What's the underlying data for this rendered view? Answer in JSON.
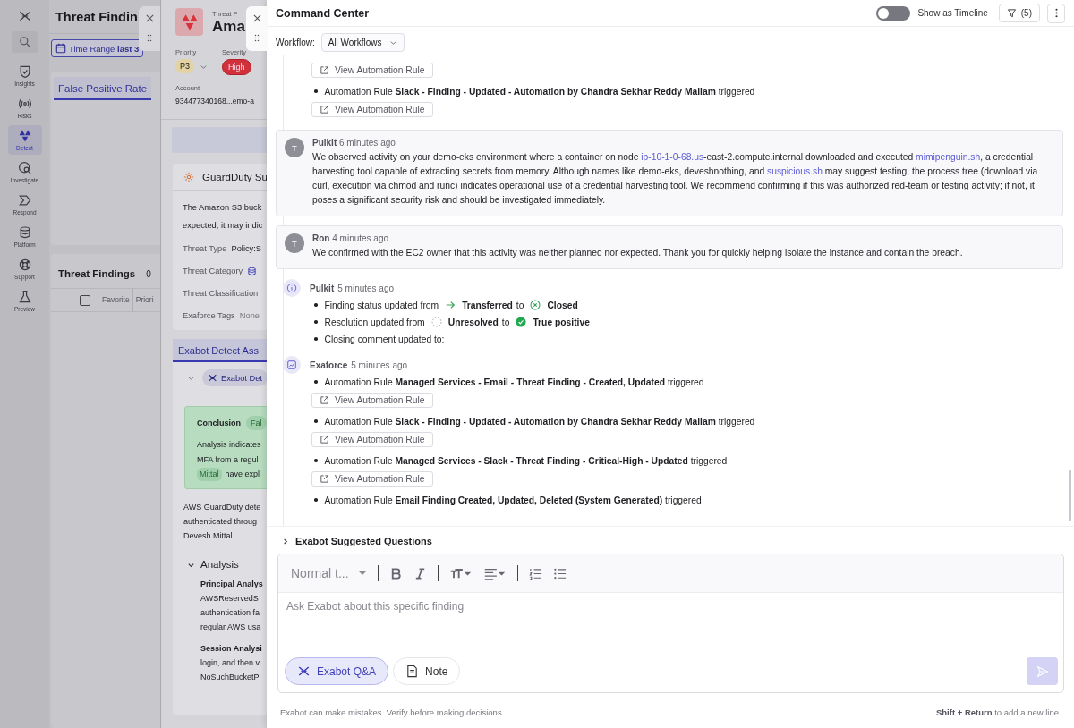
{
  "nav": {
    "items": [
      {
        "label": "Insights",
        "selected": false
      },
      {
        "label": "Risks",
        "selected": false
      },
      {
        "label": "Detect",
        "selected": true
      },
      {
        "label": "Investigate",
        "selected": false
      },
      {
        "label": "Respond",
        "selected": false
      },
      {
        "label": "Platform",
        "selected": false
      },
      {
        "label": "Support",
        "selected": false
      },
      {
        "label": "Preview",
        "selected": false
      }
    ]
  },
  "background_page": {
    "title": "Threat Findin",
    "time_range": {
      "label": "Time Range",
      "value": "last 3"
    },
    "tabs": [
      {
        "label": "False Positive Rate",
        "selected": true
      }
    ],
    "findings": {
      "title": "Threat Findings",
      "count": "0",
      "select_all": {
        "checked": false
      },
      "columns": [
        "Favorite",
        "Priori"
      ]
    }
  },
  "finding_panel": {
    "overline": "Threat F",
    "title": "Ama",
    "priority": {
      "label": "Priority",
      "value": "P3"
    },
    "severity": {
      "label": "Severity",
      "value": "High"
    },
    "account": {
      "label": "Account",
      "value": "934477340168...emo-a"
    },
    "summary": {
      "title": "GuardDuty Su",
      "lines": [
        "The Amazon S3 buck",
        "expected, it may indic"
      ],
      "fields": [
        {
          "label": "Threat Type",
          "value": "Policy:S"
        },
        {
          "label": "Threat Category"
        },
        {
          "label": "Threat Classification"
        },
        {
          "label": "Exaforce Tags",
          "value": "None"
        }
      ]
    },
    "assessment": {
      "tab": "Exabot Detect Ass",
      "chip": "Exabot Det",
      "conclusion": {
        "label": "Conclusion",
        "value": "Fal",
        "lines": [
          "Analysis indicates",
          "MFA from a regul"
        ],
        "tag": "Mittal",
        "tail": "have expl"
      },
      "paragraph": [
        "AWS GuardDuty dete",
        "authenticated throug",
        "Devesh Mittal."
      ],
      "analysis": {
        "title": "Analysis",
        "expanded": true,
        "sections": [
          {
            "title": "Principal Analys",
            "lines": [
              "AWSReservedS",
              "authentication fa",
              "regular AWS usa"
            ]
          },
          {
            "title": "Session Analysi",
            "lines": [
              "login, and then v",
              "NoSuchBucketP"
            ]
          }
        ]
      }
    }
  },
  "command_center": {
    "title": "Command Center",
    "timeline_toggle": {
      "label": "Show as Timeline",
      "on": false
    },
    "filter": {
      "label": "(5)"
    },
    "workflow": {
      "label": "Workflow:",
      "value": "All Workflows"
    },
    "activity": [
      {
        "kind": "automation",
        "items": [
          {
            "link": "View Automation Rule"
          },
          {
            "text": "Automation Rule **Slack - Finding - Updated - Automation by Chandra Sekhar Reddy Mallam** triggered",
            "link": "View Automation Rule"
          }
        ]
      },
      {
        "kind": "comment",
        "avatar": "T",
        "author": "Pulkit",
        "time": "6 minutes ago",
        "body": [
          {
            "text": "We observed activity on your demo-eks environment where a container on node "
          },
          {
            "link": "ip-10-1-0-68.us"
          },
          {
            "text": "-east-2.compute.internal downloaded and executed "
          },
          {
            "link": "mimipenguin.sh"
          },
          {
            "text": ", a credential harvesting tool capable of extracting secrets from memory. Although names like demo-eks, deveshnothing, and "
          },
          {
            "link": "suspicious.sh"
          },
          {
            "text": " may suggest testing, the process tree (download via curl, execution via chmod and runc) indicates operational use of a credential harvesting tool. We recommend confirming if this was authorized red-team or testing activity; if not, it poses a significant security risk and should be investigated immediately."
          }
        ]
      },
      {
        "kind": "comment",
        "avatar": "T",
        "author": "Ron",
        "time": "4 minutes ago",
        "body": [
          {
            "text": "We confirmed with the EC2 owner that this activity was neither planned nor expected. Thank you for quickly helping isolate the instance and contain the breach."
          }
        ]
      },
      {
        "kind": "status",
        "author": "Pulkit",
        "time": "5 minutes ago",
        "changes": [
          {
            "label": "Finding status updated from",
            "from": {
              "kind": "transferred",
              "text": "Transferred"
            },
            "connector": "to",
            "to": {
              "kind": "closed",
              "text": "Closed"
            }
          },
          {
            "label": "Resolution updated from",
            "from": {
              "kind": "unresolved",
              "text": "Unresolved"
            },
            "connector": "to",
            "to": {
              "kind": "true_positive",
              "text": "True positive"
            }
          },
          {
            "label": "Closing comment updated to:"
          }
        ]
      },
      {
        "kind": "automation",
        "author": "Exaforce",
        "time": "5 minutes ago",
        "items": [
          {
            "text": "Automation Rule **Managed Services - Email - Threat Finding - Created, Updated** triggered",
            "link": "View Automation Rule"
          },
          {
            "text": "Automation Rule **Slack - Finding - Updated - Automation by Chandra Sekhar Reddy Mallam** triggered",
            "link": "View Automation Rule"
          },
          {
            "text": "Automation Rule **Managed Services - Slack - Threat Finding - Critical-High - Updated** triggered",
            "link": "View Automation Rule"
          },
          {
            "text": "Automation Rule **Email Finding Created, Updated, Deleted (System Generated)** triggered"
          }
        ]
      }
    ],
    "suggested": {
      "label": "Exabot Suggested Questions",
      "expanded": false
    },
    "composer": {
      "text_style": "Normal t...",
      "placeholder": "Ask Exabot about this specific finding",
      "modes": [
        {
          "label": "Exabot Q&A",
          "selected": true
        },
        {
          "label": "Note",
          "selected": false
        }
      ]
    },
    "disclaimer": "Exabot can make mistakes. Verify before making decisions.",
    "hint": "**Shift + Return** to add a new line"
  }
}
